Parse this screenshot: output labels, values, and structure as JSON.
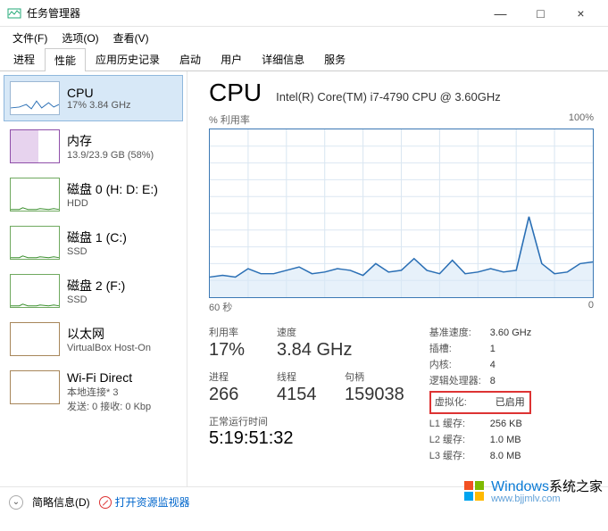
{
  "window": {
    "title": "任务管理器",
    "controls": {
      "min": "—",
      "max": "□",
      "close": "×"
    }
  },
  "menu": {
    "file": "文件(F)",
    "options": "选项(O)",
    "view": "查看(V)"
  },
  "tabs": {
    "items": [
      "进程",
      "性能",
      "应用历史记录",
      "启动",
      "用户",
      "详细信息",
      "服务"
    ],
    "active_index": 1
  },
  "sidebar": {
    "items": [
      {
        "title": "CPU",
        "sub": "17% 3.84 GHz",
        "kind": "cpu",
        "selected": true
      },
      {
        "title": "内存",
        "sub": "13.9/23.9 GB (58%)",
        "kind": "mem"
      },
      {
        "title": "磁盘 0 (H: D: E:)",
        "sub": "HDD",
        "kind": "disk"
      },
      {
        "title": "磁盘 1 (C:)",
        "sub": "SSD",
        "kind": "disk"
      },
      {
        "title": "磁盘 2 (F:)",
        "sub": "SSD",
        "kind": "disk"
      },
      {
        "title": "以太网",
        "sub": "VirtualBox Host-On",
        "kind": "eth"
      },
      {
        "title": "Wi-Fi Direct",
        "sub": "本地连接* 3",
        "sub2": "发送: 0 接收: 0 Kbp",
        "kind": "eth"
      }
    ]
  },
  "main": {
    "title": "CPU",
    "subtitle": "Intel(R) Core(TM) i7-4790 CPU @ 3.60GHz",
    "chart": {
      "ylabel": "% 利用率",
      "ymax": "100%",
      "xmin": "60 秒",
      "xmax": "0"
    },
    "stats_left": {
      "row1": [
        {
          "label": "利用率",
          "value": "17%"
        },
        {
          "label": "速度",
          "value": "3.84 GHz"
        }
      ],
      "row2": [
        {
          "label": "进程",
          "value": "266"
        },
        {
          "label": "线程",
          "value": "4154"
        },
        {
          "label": "句柄",
          "value": "159038"
        }
      ],
      "uptime_label": "正常运行时间",
      "uptime_value": "5:19:51:32"
    },
    "details": [
      {
        "k": "基准速度:",
        "v": "3.60 GHz"
      },
      {
        "k": "插槽:",
        "v": "1"
      },
      {
        "k": "内核:",
        "v": "4"
      },
      {
        "k": "逻辑处理器:",
        "v": "8"
      },
      {
        "k": "虚拟化:",
        "v": "已启用",
        "hl": true
      },
      {
        "k": "L1 缓存:",
        "v": "256 KB"
      },
      {
        "k": "L2 缓存:",
        "v": "1.0 MB"
      },
      {
        "k": "L3 缓存:",
        "v": "8.0 MB"
      }
    ]
  },
  "footer": {
    "fewer": "简略信息(D)",
    "resmon": "打开资源监视器"
  },
  "watermark": {
    "brand": "Windows",
    "suffix": "系统之家",
    "url": "www.bjjmlv.com"
  },
  "chart_data": {
    "type": "line",
    "title": "CPU % 利用率",
    "xlabel": "秒",
    "ylabel": "% 利用率",
    "ylim": [
      0,
      100
    ],
    "x": [
      60,
      58,
      56,
      54,
      52,
      50,
      48,
      46,
      44,
      42,
      40,
      38,
      36,
      34,
      32,
      30,
      28,
      26,
      24,
      22,
      20,
      18,
      16,
      14,
      12,
      10,
      8,
      6,
      4,
      2,
      0
    ],
    "values": [
      12,
      13,
      12,
      17,
      14,
      14,
      16,
      18,
      14,
      15,
      17,
      16,
      13,
      20,
      15,
      16,
      23,
      16,
      14,
      22,
      14,
      15,
      17,
      15,
      16,
      48,
      20,
      14,
      15,
      20,
      21
    ]
  }
}
